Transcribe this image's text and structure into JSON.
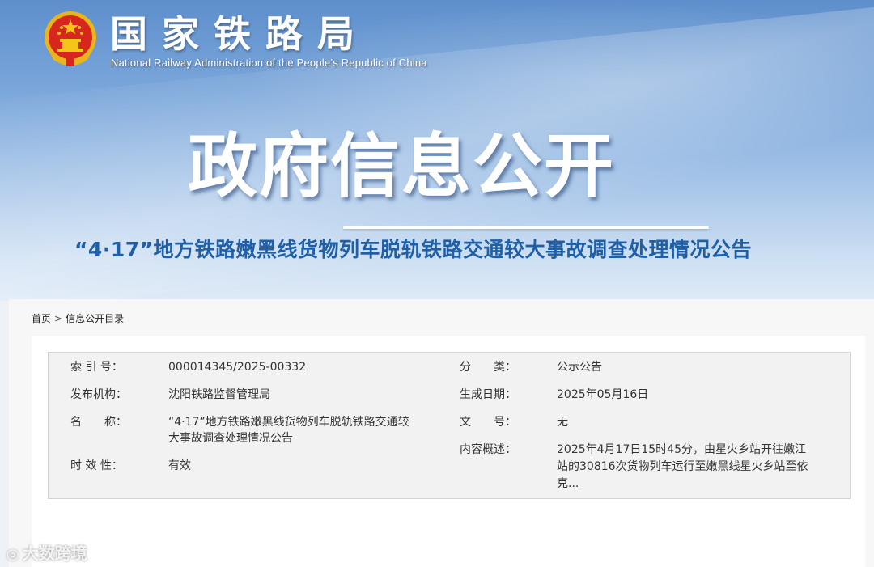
{
  "header": {
    "org_name_cn": "国家铁路局",
    "org_name_en": "National Railway Administration of the People’s Republic of China",
    "hero_title": "政府信息公开"
  },
  "breadcrumb": {
    "home": "首页",
    "separator": ">",
    "current": "信息公开目录"
  },
  "meta": {
    "index_label": "索 引 号：",
    "index_value": "000014345/2025-00332",
    "category_label": "分　　类：",
    "category_value": "公示公告",
    "publisher_label": "发布机构：",
    "publisher_value": "沈阳铁路监督管理局",
    "date_label": "生成日期：",
    "date_value": "2025年05月16日",
    "name_label": "名　　称：",
    "name_value_line1": "“4·17”地方铁路嫩黑线货物列车脱轨铁路交通较",
    "name_value_line2": "大事故调查处理情况公告",
    "docno_label": "文　　号：",
    "docno_value": "无",
    "summary_label": "内容概述：",
    "summary_line1": "2025年4月17日15时45分，由星火乡站开往嫩江",
    "summary_line2": "站的30816次货物列车运行至嫩黑线星火乡站至依",
    "summary_line3": "克...",
    "validity_label": "时 效 性：",
    "validity_value": "有效"
  },
  "document": {
    "title": "“4·17”地方铁路嫩黑线货物列车脱轨铁路交通较大事故调查处理情况公告"
  },
  "watermark": {
    "text": "大数跨境"
  },
  "colors": {
    "banner_top": "#5e8fcc",
    "title_blue": "#1f5fa6",
    "emblem_red": "#d7261e",
    "emblem_gold": "#f5c518"
  }
}
